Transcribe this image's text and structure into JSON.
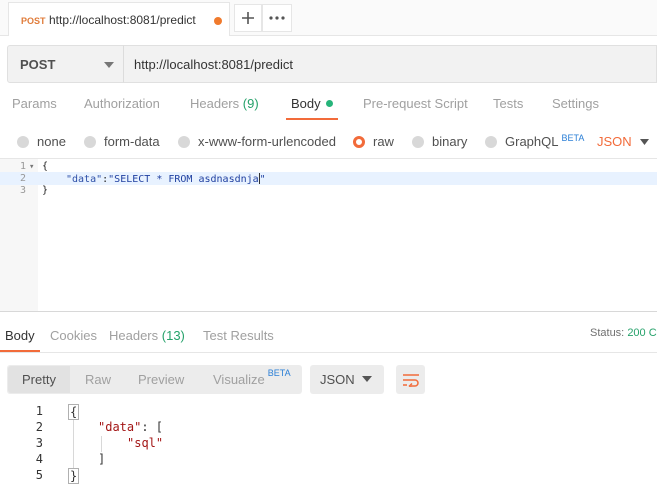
{
  "tab": {
    "method": "POST",
    "url": "http://localhost:8081/predict"
  },
  "request": {
    "method": "POST",
    "url": "http://localhost:8081/predict"
  },
  "request_tabs": {
    "params": "Params",
    "authorization": "Authorization",
    "headers": "Headers",
    "headers_count": "(9)",
    "body": "Body",
    "prerequest": "Pre-request Script",
    "tests": "Tests",
    "settings": "Settings"
  },
  "body_types": {
    "none": "none",
    "form_data": "form-data",
    "urlencoded": "x-www-form-urlencoded",
    "raw": "raw",
    "binary": "binary",
    "graphql": "GraphQL",
    "beta": "BETA",
    "format": "JSON"
  },
  "editor": {
    "line_numbers": [
      "1",
      "2",
      "3"
    ],
    "line1": "{",
    "line2_key": "\"data\"",
    "line2_colon": ":",
    "line2_value": "\"SELECT * FROM asdnasdnja",
    "line2_close": "\"",
    "line3": "}"
  },
  "response_tabs": {
    "body": "Body",
    "cookies": "Cookies",
    "headers": "Headers",
    "headers_count": "(13)",
    "test_results": "Test Results"
  },
  "status": {
    "label": "Status:",
    "value": "200 C"
  },
  "response_view": {
    "pretty": "Pretty",
    "raw": "Raw",
    "preview": "Preview",
    "visualize": "Visualize",
    "beta": "BETA",
    "format": "JSON"
  },
  "response_body": {
    "line_numbers": [
      "1",
      "2",
      "3",
      "4",
      "5"
    ],
    "line1": "{",
    "line2_key": "\"data\"",
    "line2_rest": ": [",
    "line3": "\"sql\"",
    "line4": "]",
    "line5": "}"
  },
  "colors": {
    "accent": "#f26b3a",
    "success": "#26a26b",
    "beta": "#2b7fd6"
  }
}
